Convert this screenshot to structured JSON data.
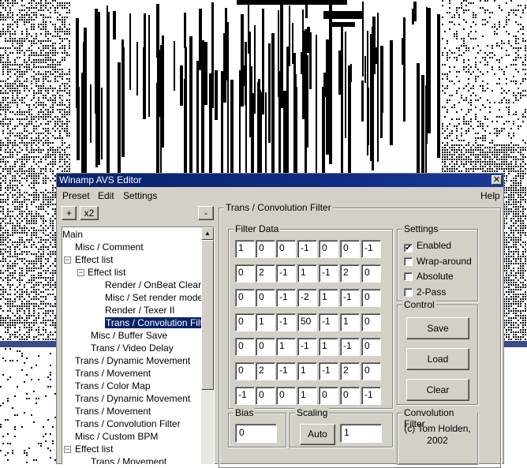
{
  "window": {
    "title": "Winamp AVS Editor",
    "close": "✕"
  },
  "menu": {
    "preset": "Preset",
    "edit": "Edit",
    "settings": "Settings",
    "help": "Help"
  },
  "toolbar": {
    "add": "+",
    "x2": "x2",
    "remove": "-"
  },
  "tree": [
    {
      "label": "Main"
    },
    {
      "label": "Misc / Comment"
    },
    {
      "label": "Effect list",
      "expander": "⊟"
    },
    {
      "label": "Effect list",
      "expander": "⊟"
    },
    {
      "label": "Render / OnBeat Clear"
    },
    {
      "label": "Misc / Set render mode"
    },
    {
      "label": "Render / Texer II"
    },
    {
      "label": "Trans / Convolution Filter",
      "selected": true
    },
    {
      "label": "Misc / Buffer Save"
    },
    {
      "label": "Trans / Video Delay"
    },
    {
      "label": "Trans / Dynamic Movement"
    },
    {
      "label": "Trans / Movement"
    },
    {
      "label": "Trans / Color Map"
    },
    {
      "label": "Trans / Dynamic Movement"
    },
    {
      "label": "Trans / Movement"
    },
    {
      "label": "Trans / Convolution Filter"
    },
    {
      "label": "Misc / Custom BPM"
    },
    {
      "label": "Effect list",
      "expander": "⊟"
    },
    {
      "label": "Trans / Movement"
    }
  ],
  "panel": {
    "title": "Trans / Convolution Filter",
    "filter_data_label": "Filter Data",
    "matrix": [
      [
        "1",
        "0",
        "0",
        "-1",
        "0",
        "0",
        "-1"
      ],
      [
        "0",
        "2",
        "-1",
        "1",
        "-1",
        "2",
        "0"
      ],
      [
        "0",
        "0",
        "-1",
        "-2",
        "1",
        "-1",
        "0"
      ],
      [
        "0",
        "1",
        "-1",
        "50",
        "-1",
        "1",
        "0"
      ],
      [
        "0",
        "0",
        "1",
        "-1",
        "1",
        "-1",
        "0"
      ],
      [
        "0",
        "2",
        "-1",
        "1",
        "-1",
        "2",
        "0"
      ],
      [
        "-1",
        "0",
        "0",
        "1",
        "0",
        "0",
        "-1"
      ]
    ],
    "settings_label": "Settings",
    "enabled_label": "Enabled",
    "enabled_checked": true,
    "wrap_label": "Wrap-around",
    "absolute_label": "Absolute",
    "twopass_label": "2-Pass",
    "control_label": "Control",
    "save_label": "Save",
    "load_label": "Load",
    "clear_label": "Clear",
    "bias_label": "Bias",
    "bias_value": "0",
    "scaling_label": "Scaling",
    "auto_label": "Auto",
    "scaling_value": "1",
    "credits_label": "Convolution Filter",
    "credits_line1": "(c) Tom Holden,",
    "credits_line2": "2002"
  },
  "colors": {
    "titlebar": "#0a246a",
    "face": "#d4d0c8",
    "selection": "#0a246a"
  }
}
